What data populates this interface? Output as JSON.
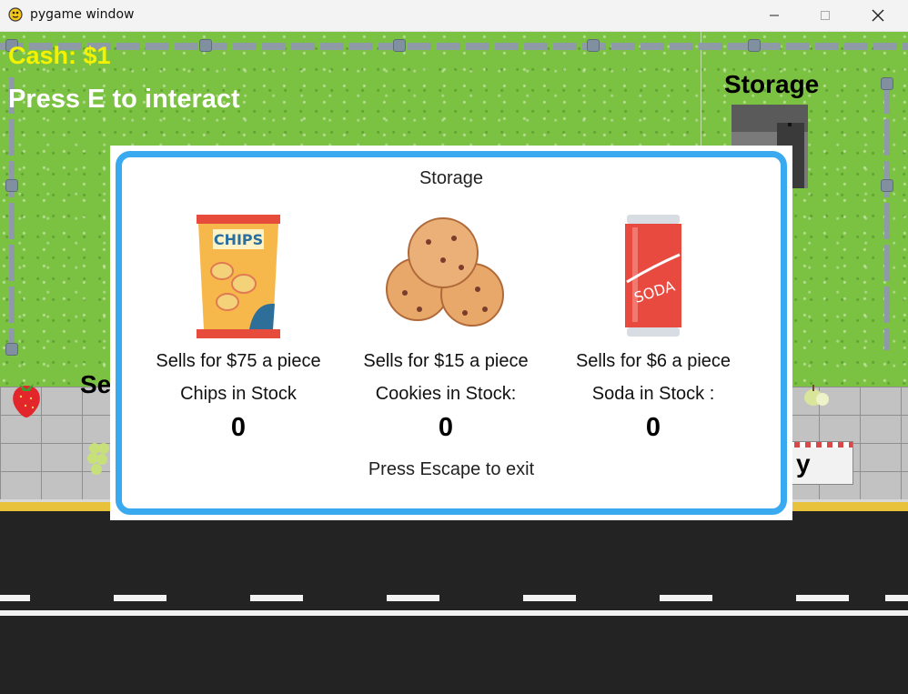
{
  "window": {
    "title": "pygame window",
    "icon": "pygame-snake-icon",
    "controls": [
      "minimize-icon",
      "maximize-icon",
      "close-icon"
    ]
  },
  "hud": {
    "cash": "Cash: $1",
    "hint": "Press E to interact"
  },
  "world": {
    "storage_label": "Storage",
    "sell_sign": "Se",
    "buy_sign": "y"
  },
  "panel": {
    "title": "Storage",
    "items": [
      {
        "icon": "chips-bag-icon",
        "price": "Sells for $75 a piece",
        "stock_label": "Chips in Stock",
        "qty": "0"
      },
      {
        "icon": "cookies-icon",
        "price": "Sells for $15 a piece",
        "stock_label": "Cookies in Stock:",
        "qty": "0"
      },
      {
        "icon": "soda-can-icon",
        "price": "Sells for $6 a piece",
        "stock_label": "Soda in Stock :",
        "qty": "0"
      }
    ],
    "exit_hint": "Press Escape to exit",
    "border_color": "#3aaaf0"
  },
  "colors": {
    "grass": "#7cc242",
    "cash_text": "#f5f200",
    "road": "#232323",
    "road_edge": "#e8c23a"
  }
}
